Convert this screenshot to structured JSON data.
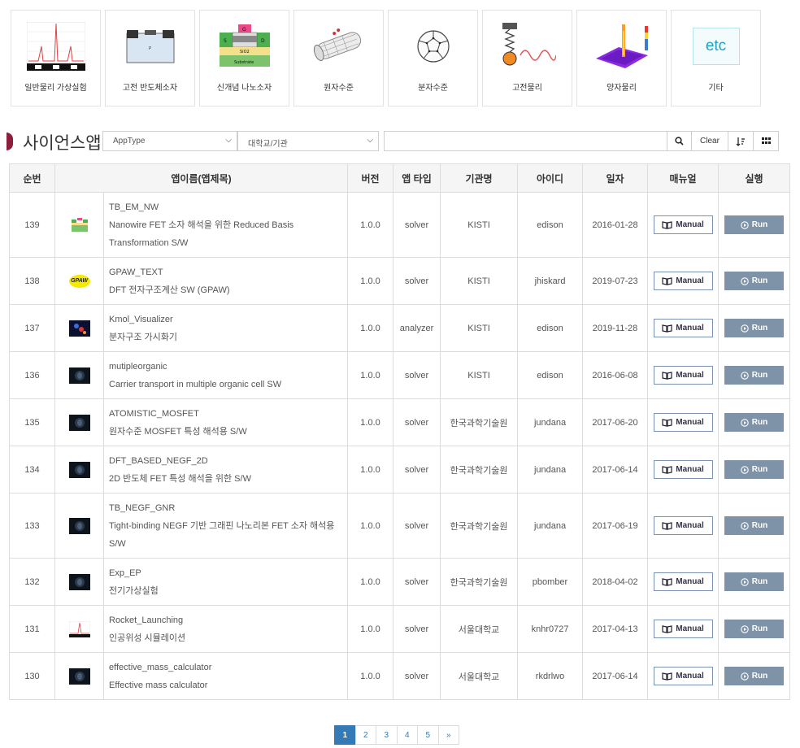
{
  "categories": [
    {
      "label": "일반물리 가상실험",
      "icon": "spectrum-plot-icon"
    },
    {
      "label": "고전 반도체소자",
      "icon": "semiconductor-device-icon"
    },
    {
      "label": "신개념 나노소자",
      "icon": "nano-device-icon"
    },
    {
      "label": "원자수준",
      "icon": "nanotube-icon"
    },
    {
      "label": "분자수준",
      "icon": "fullerene-icon"
    },
    {
      "label": "고전물리",
      "icon": "spring-oscillator-icon"
    },
    {
      "label": "양자물리",
      "icon": "quantum-plot-icon"
    },
    {
      "label": "기타",
      "icon": "etc-icon",
      "icon_text": "etc"
    }
  ],
  "toolbar": {
    "title": "사이언스앱",
    "apptype_select": "AppType",
    "org_select": "대학교/기관",
    "search_value": "",
    "clear_label": "Clear"
  },
  "table": {
    "headers": {
      "no": "순번",
      "name": "앱이름(앱제목)",
      "version": "버전",
      "type": "앱 타입",
      "org": "기관명",
      "id": "아이디",
      "date": "일자",
      "manual": "매뉴얼",
      "run": "실행"
    },
    "manual_label": "Manual",
    "run_label": "Run",
    "rows": [
      {
        "no": "139",
        "name": "TB_EM_NW",
        "title": "Nanowire FET 소자 해석을 위한 Reduced Basis Transformation S/W",
        "version": "1.0.0",
        "type": "solver",
        "org": "KISTI",
        "user": "edison",
        "date": "2016-01-28",
        "thumb": "nanowire-thumb"
      },
      {
        "no": "138",
        "name": "GPAW_TEXT",
        "title": "DFT 전자구조계산 SW (GPAW)",
        "version": "1.0.0",
        "type": "solver",
        "org": "KISTI",
        "user": "jhiskard",
        "date": "2019-07-23",
        "thumb": "gpaw-thumb",
        "thumb_text": "GPAW"
      },
      {
        "no": "137",
        "name": "Kmol_Visualizer",
        "title": "분자구조 가시화기",
        "version": "1.0.0",
        "type": "analyzer",
        "org": "KISTI",
        "user": "edison",
        "date": "2019-11-28",
        "thumb": "molecule-thumb"
      },
      {
        "no": "136",
        "name": "mutipleorganic",
        "title": "Carrier transport in multiple organic cell SW",
        "version": "1.0.0",
        "type": "solver",
        "org": "KISTI",
        "user": "edison",
        "date": "2016-06-08",
        "thumb": "dark-thumb"
      },
      {
        "no": "135",
        "name": "ATOMISTIC_MOSFET",
        "title": "원자수준 MOSFET 특성 해석용 S/W",
        "version": "1.0.0",
        "type": "solver",
        "org": "한국과학기술원",
        "user": "jundana",
        "date": "2017-06-20",
        "thumb": "dark-thumb"
      },
      {
        "no": "134",
        "name": "DFT_BASED_NEGF_2D",
        "title": "2D 반도체 FET 특성 해석을 위한 S/W",
        "version": "1.0.0",
        "type": "solver",
        "org": "한국과학기술원",
        "user": "jundana",
        "date": "2017-06-14",
        "thumb": "dark-thumb"
      },
      {
        "no": "133",
        "name": "TB_NEGF_GNR",
        "title": "Tight-binding NEGF 기반 그래핀 나노리본 FET 소자 해석용 S/W",
        "version": "1.0.0",
        "type": "solver",
        "org": "한국과학기술원",
        "user": "jundana",
        "date": "2017-06-19",
        "thumb": "dark-thumb"
      },
      {
        "no": "132",
        "name": "Exp_EP",
        "title": "전기가상실험",
        "version": "1.0.0",
        "type": "solver",
        "org": "한국과학기술원",
        "user": "pbomber",
        "date": "2018-04-02",
        "thumb": "dark-thumb"
      },
      {
        "no": "131",
        "name": "Rocket_Launching",
        "title": "인공위성 시뮬레이션",
        "version": "1.0.0",
        "type": "solver",
        "org": "서울대학교",
        "user": "knhr0727",
        "date": "2017-04-13",
        "thumb": "spectrum-thumb"
      },
      {
        "no": "130",
        "name": "effective_mass_calculator",
        "title": "Effective mass calculator",
        "version": "1.0.0",
        "type": "solver",
        "org": "서울대학교",
        "user": "rkdrlwo",
        "date": "2017-06-14",
        "thumb": "dark-thumb"
      }
    ]
  },
  "pagination": {
    "pages": [
      "1",
      "2",
      "3",
      "4",
      "5"
    ],
    "next": "»",
    "current": "1"
  },
  "colors": {
    "accent": "#337ab7",
    "title_mark": "#8c1f3e",
    "run_button": "#7f93a8",
    "manual_border": "#7b93b3"
  }
}
